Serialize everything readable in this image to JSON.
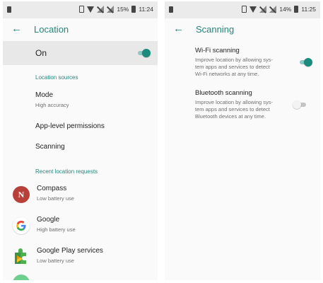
{
  "left": {
    "status": {
      "battery": "15%",
      "time": "11:24"
    },
    "title": "Location",
    "master_label": "On",
    "sections": {
      "sources": "Location sources",
      "recent": "Recent location requests"
    },
    "mode": {
      "title": "Mode",
      "value": "High accuracy"
    },
    "app_level": "App-level permissions",
    "scanning": "Scanning",
    "apps": [
      {
        "name": "Compass",
        "usage": "Low battery use",
        "icon": "compass-icon",
        "letter": "N"
      },
      {
        "name": "Google",
        "usage": "High battery use",
        "icon": "google-icon"
      },
      {
        "name": "Google Play services",
        "usage": "Low battery use",
        "icon": "puzzle-icon"
      }
    ],
    "master_on": true
  },
  "right": {
    "status": {
      "battery": "14%",
      "time": "11:25"
    },
    "title": "Scanning",
    "wifi": {
      "title": "Wi-Fi scanning",
      "desc": "Improve location by allowing sys-\ntem apps and services to detect\nWi-Fi networks at any time.",
      "on": true
    },
    "bluetooth": {
      "title": "Bluetooth scanning",
      "desc": "Improve location by allowing sys-\ntem apps and services to detect\nBluetooth devices at any time.",
      "on": false
    }
  },
  "colors": {
    "accent": "#26857a",
    "toggle_on": "#1c8a7c",
    "header_bg": "#e8e8e8",
    "status_bg": "#ebebeb"
  }
}
